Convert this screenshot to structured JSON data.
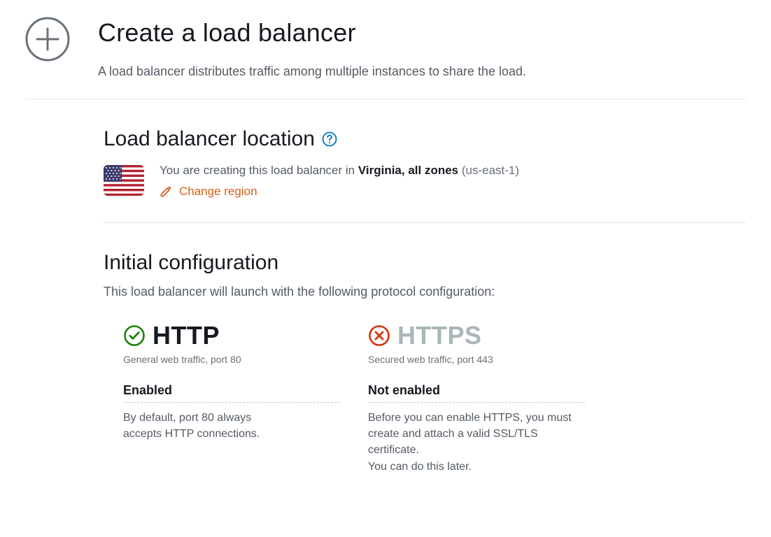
{
  "header": {
    "title": "Create a load balancer",
    "subtitle": "A load balancer distributes traffic among multiple instances to share the load."
  },
  "location_section": {
    "title": "Load balancer location",
    "intro": "You are creating this load balancer in ",
    "region_name": "Virginia, all zones",
    "region_code": " (us-east-1)",
    "change_region_label": "Change region"
  },
  "config_section": {
    "title": "Initial configuration",
    "description": "This load balancer will launch with the following protocol configuration:"
  },
  "protocols": {
    "http": {
      "name": "HTTP",
      "subtitle": "General web traffic, port 80",
      "status": "Enabled",
      "detail": "By default, port 80 always accepts HTTP connections."
    },
    "https": {
      "name": "HTTPS",
      "subtitle": "Secured web traffic, port 443",
      "status": "Not enabled",
      "detail": "Before you can enable HTTPS, you must create and attach a valid SSL/TLS certificate.\nYou can do this later."
    }
  }
}
